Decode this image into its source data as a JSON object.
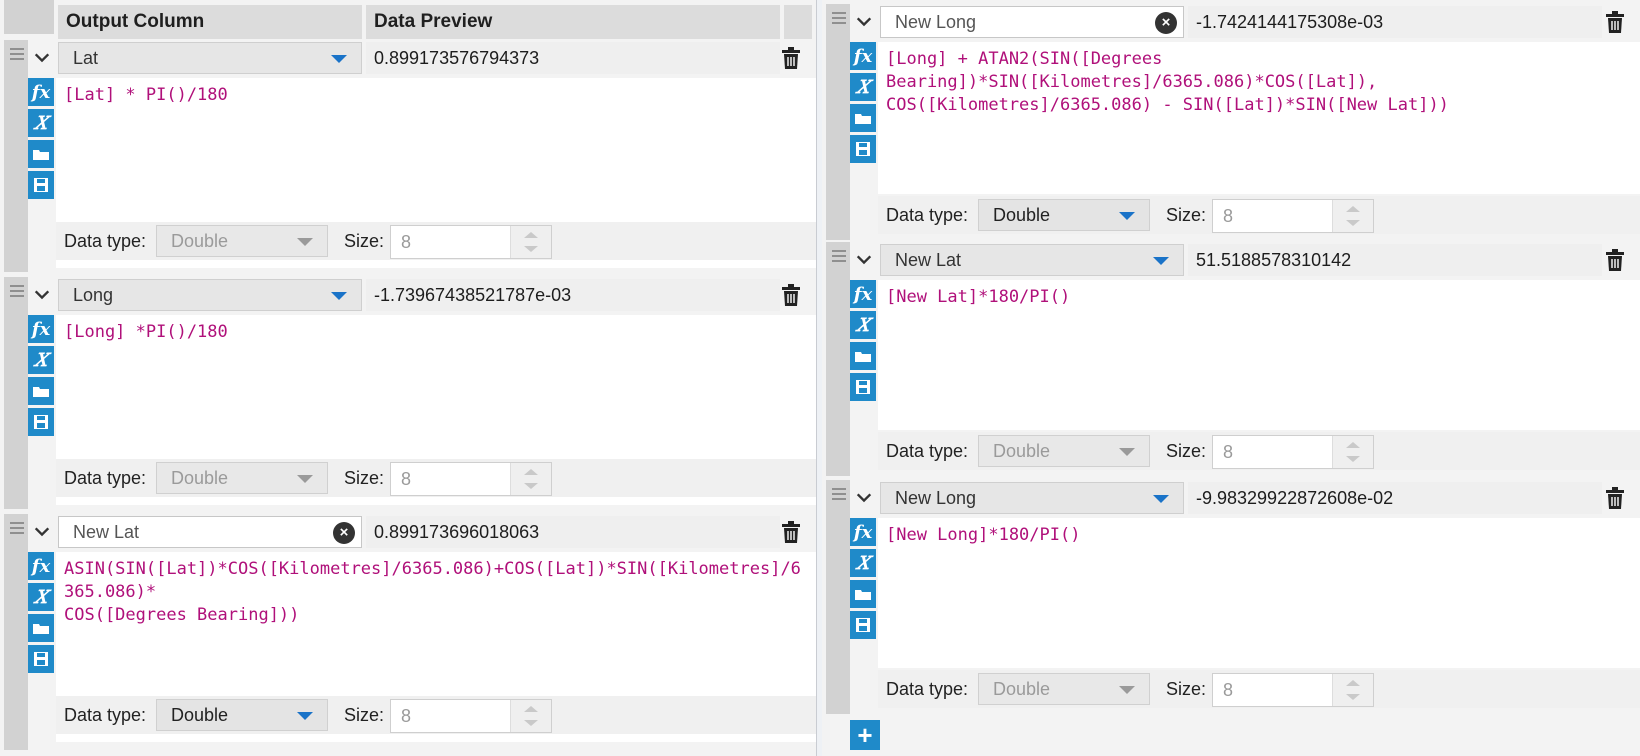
{
  "header": {
    "output_column": "Output Column",
    "data_preview": "Data Preview"
  },
  "labels": {
    "data_type": "Data type:",
    "size": "Size:"
  },
  "left": [
    {
      "name": "Lat",
      "preview": "0.899173576794373",
      "data_type": "Double",
      "size": "8",
      "datatype_enabled": false
    },
    {
      "name": "Long",
      "preview": "-1.73967438521787e-03",
      "data_type": "Double",
      "size": "8",
      "datatype_enabled": false
    },
    {
      "name": "New Lat",
      "preview": "0.899173696018063",
      "data_type": "Double",
      "size": "8",
      "datatype_enabled": true
    }
  ],
  "right": [
    {
      "name": "New Long",
      "preview": "-1.7424144175308e-03",
      "data_type": "Double",
      "size": "8",
      "datatype_enabled": true
    },
    {
      "name": "New Lat",
      "preview": "51.5188578310142",
      "data_type": "Double",
      "size": "8",
      "datatype_enabled": false
    },
    {
      "name": "New Long",
      "preview": "-9.98329922872608e-02",
      "data_type": "Double",
      "size": "8",
      "datatype_enabled": false
    }
  ],
  "formulas": {
    "left_0": "[Lat] * PI()/180",
    "left_1": "[Long] *PI()/180",
    "left_2": "ASIN(SIN([Lat])*COS([Kilometres]/6365.086)+COS([Lat])*SIN([Kilometres]/6365.086)*\nCOS([Degrees Bearing]))",
    "right_0": "[Long] + ATAN2(SIN([Degrees\nBearing])*SIN([Kilometres]/6365.086)*COS([Lat]),\nCOS([Kilometres]/6365.086) - SIN([Lat])*SIN([New Lat]))",
    "right_1": "[New Lat]*180/PI()",
    "right_2": "[New Long]*180/PI()"
  },
  "icons": [
    "grip-icon",
    "chevron-down-icon",
    "dropdown-arrow-icon",
    "clear-icon",
    "trash-icon",
    "fx-icon",
    "variable-icon",
    "open-icon",
    "save-icon",
    "add-icon"
  ],
  "colors": {
    "accent": "#1f8ac9",
    "field": "#b0107a",
    "function": "#c8641a"
  }
}
